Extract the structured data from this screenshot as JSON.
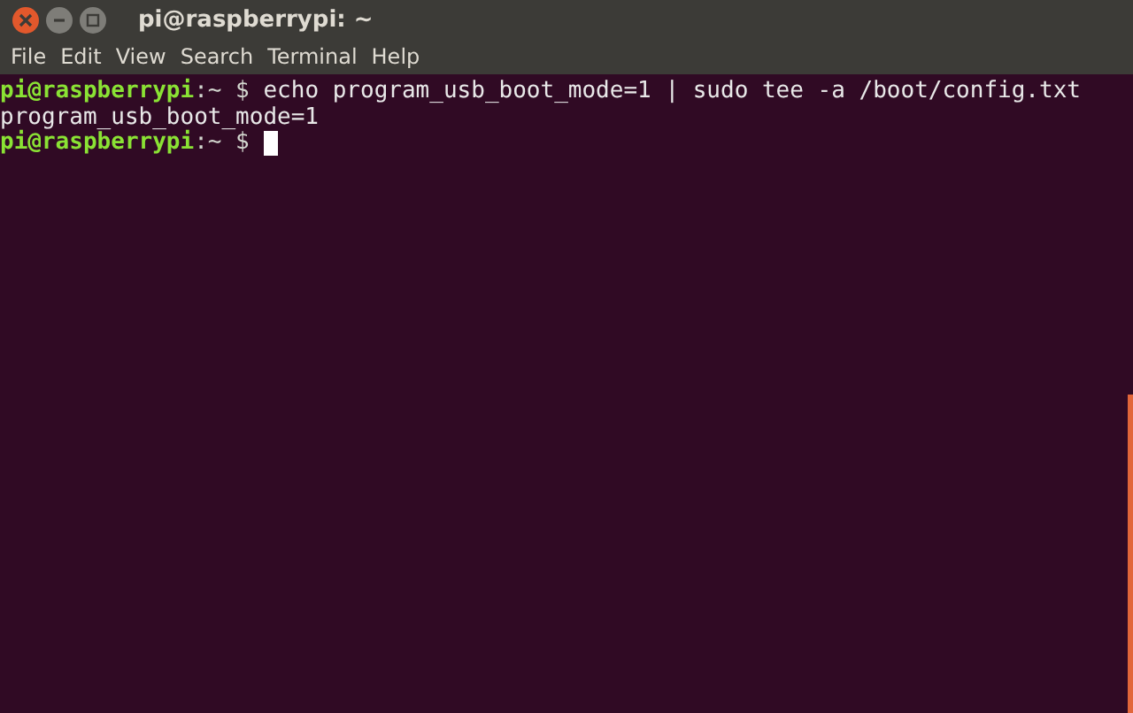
{
  "window": {
    "title": "pi@raspberrypi: ~"
  },
  "menu": [
    "File",
    "Edit",
    "View",
    "Search",
    "Terminal",
    "Help"
  ],
  "lines": [
    {
      "kind": "prompt",
      "user_host": "pi@raspberrypi",
      "path": ":~ $",
      "command": "echo program_usb_boot_mode=1 | sudo tee -a /boot/config.txt",
      "cursor": false
    },
    {
      "kind": "output",
      "text": "program_usb_boot_mode=1"
    },
    {
      "kind": "prompt",
      "user_host": "pi@raspberrypi",
      "path": ":~ $",
      "cursor": true
    }
  ]
}
